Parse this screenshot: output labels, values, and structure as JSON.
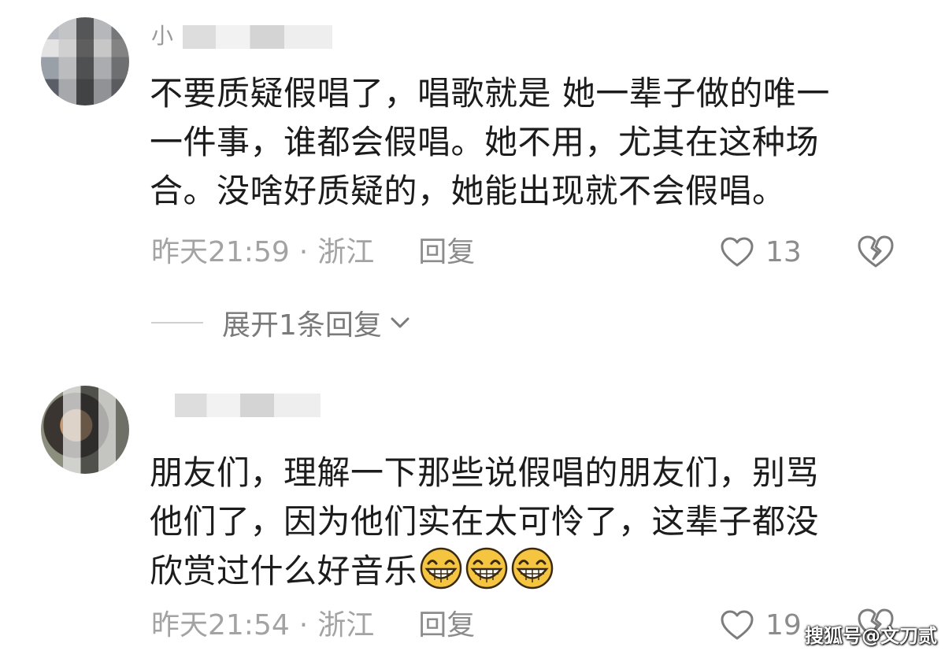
{
  "comments": [
    {
      "username_visible": "小",
      "avatar": "blurred-avatar",
      "lines": [
        "不要质疑假唱了，唱歌就是 她一辈子做的唯一",
        "一件事，谁都会假唱。她不用，尤其在这种场",
        "合。没啥好质疑的，她能出现就不会假唱。"
      ],
      "time": "昨天21:59",
      "separator": "·",
      "location": "浙江",
      "reply_label": "回复",
      "like_count": "13",
      "expand_label": "展开1条回复"
    },
    {
      "username_visible": "",
      "avatar": "blurred-avatar",
      "lines": [
        "朋友们，理解一下那些说假唱的朋友们，别骂",
        "他们了，因为他们实在太可怜了，这辈子都没",
        "欣赏过什么好音乐"
      ],
      "emojis": [
        "grinning-face-emoji",
        "grinning-face-emoji",
        "grinning-face-emoji"
      ],
      "time": "昨天21:54",
      "separator": "·",
      "location": "浙江",
      "reply_label": "回复",
      "like_count": "19"
    }
  ],
  "watermark": "搜狐号@文刀贰",
  "colors": {
    "text": "#1c1c1c",
    "meta": "#a3a3a3",
    "background": "#ffffff",
    "emoji_yellow": "#f5c542"
  }
}
